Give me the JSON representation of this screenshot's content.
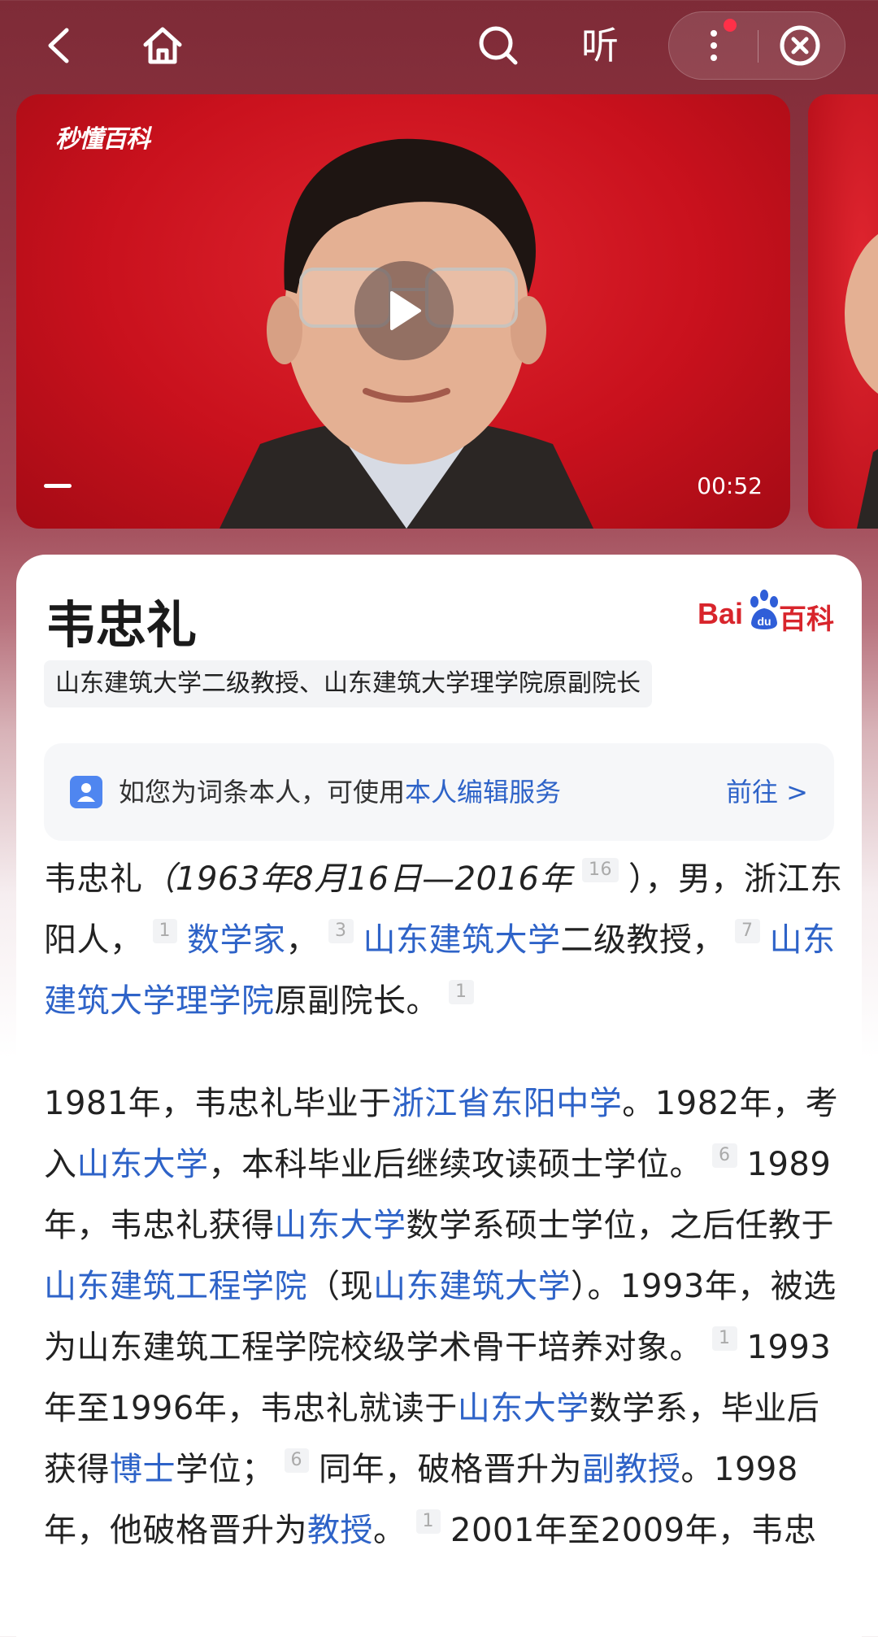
{
  "topbar": {
    "back_icon": "chevron-left-icon",
    "home_icon": "home-icon",
    "search_icon": "search-icon",
    "listen_label": "听",
    "more_icon": "more-vertical-icon",
    "close_icon": "close-circle-icon"
  },
  "video": {
    "watermark": "秒懂百科",
    "duration": "00:52"
  },
  "entry": {
    "title": "韦忠礼",
    "logo_text_bai": "Bai",
    "logo_text_du": "du",
    "logo_text_baike": "百科",
    "subtitle": "山东建筑大学二级教授、山东建筑大学理学院原副院长"
  },
  "notice": {
    "text": "如您为词条本人，可使用",
    "link": "本人编辑服务",
    "action": "前往 >"
  },
  "paragraph1": {
    "name": "韦忠礼",
    "dates": "（1963年8月16日—2016年",
    "ref_a": "16",
    "close": "），男，浙江东阳人，",
    "ref_b": "1",
    "link_a": "数学家",
    "comma": "，",
    "ref_c": "3",
    "link_b": "山东建筑大学",
    "text_b": "二级教授，",
    "ref_d": "7",
    "link_c": "山东建筑大学理学院",
    "text_c": "原副院长。",
    "ref_e": "1"
  },
  "paragraph2": {
    "t1": "1981年，韦忠礼毕业于",
    "l1": "浙江省东阳中学",
    "t2": "。1982年，考入",
    "l2": "山东大学",
    "t3": "，本科毕业后继续攻读硕士学位。",
    "r1": "6",
    "t4": "1989年，韦忠礼获得",
    "l3": "山东大学",
    "t5": "数学系硕士学位，之后任教于",
    "l4": "山东建筑工程学院",
    "t6": "（现",
    "l5": "山东建筑大学",
    "t7": "）。1993年，被选为山东建筑工程学院校级学术骨干培养对象。",
    "r2": "1",
    "t8": "1993年至1996年，韦忠礼就读于",
    "l6": "山东大学",
    "t9": "数学系，毕业后获得",
    "l7": "博士",
    "t10": "学位；",
    "r3": "6",
    "t11": "同年，破格晋升为",
    "l8": "副教授",
    "t12": "。1998年，他破格晋升为",
    "l9": "教授",
    "t13": "。",
    "r4": "1",
    "t14": "2001年至2009年，韦忠"
  }
}
